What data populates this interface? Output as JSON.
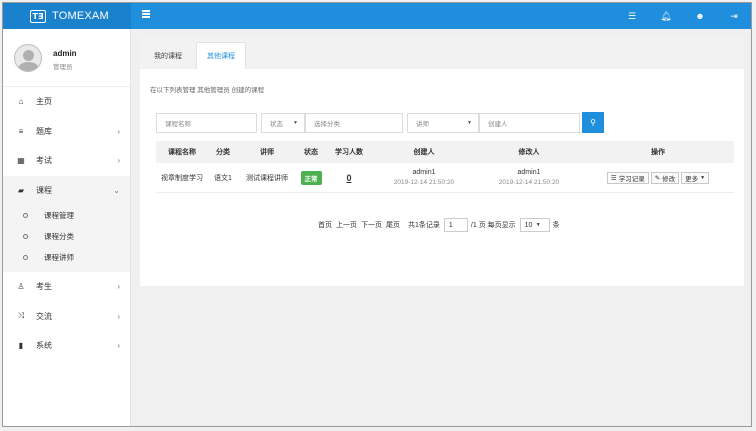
{
  "brand": {
    "logo": "T∃",
    "name": "TOMEXAM"
  },
  "topbar": {
    "icons": [
      "list-icon",
      "bell-icon",
      "user-icon",
      "logout-icon"
    ]
  },
  "user": {
    "name": "admin",
    "role": "管理员"
  },
  "nav": [
    {
      "label": "主页",
      "icon": "home-icon",
      "has_chevron": false
    },
    {
      "label": "题库",
      "icon": "database-icon",
      "has_chevron": true
    },
    {
      "label": "考试",
      "icon": "calendar-icon",
      "has_chevron": true
    },
    {
      "label": "课程",
      "icon": "book-icon",
      "has_chevron": true,
      "open": true
    },
    {
      "label": "考生",
      "icon": "user-icon",
      "has_chevron": true
    },
    {
      "label": "交流",
      "icon": "shuffle-icon",
      "has_chevron": true
    },
    {
      "label": "系统",
      "icon": "device-icon",
      "has_chevron": true
    }
  ],
  "subnav": [
    "课程管理",
    "课程分类",
    "课程讲师"
  ],
  "tabs": [
    "我的课程",
    "其他课程"
  ],
  "hint": "在以下列表管理 其他管理员 创建的课程",
  "search": {
    "name_placeholder": "课程名称",
    "status": "状态",
    "category_placeholder": "选择分类",
    "teacher": "讲师",
    "creator_placeholder": "创建人"
  },
  "table": {
    "headers": [
      "课程名称",
      "分类",
      "讲师",
      "状态",
      "学习人数",
      "创建人",
      "修改人",
      "操作"
    ],
    "rows": [
      {
        "name": "视章制度学习",
        "category": "语文1",
        "teacher": "测试课程讲师",
        "status": "正常",
        "learners": "0",
        "creator": "admin1",
        "created_at": "2019-12-14 21:50:20",
        "modifier": "admin1",
        "modified_at": "2019-12-14 21:50:20",
        "actions": [
          "学习记录",
          "修改",
          "更多"
        ]
      }
    ]
  },
  "pager": {
    "first": "首页",
    "prev": "上一页",
    "next": "下一页",
    "last": "尾页",
    "total": "共1条记录",
    "page": "1",
    "pages_suffix": "/1 页 每页显示",
    "page_size": "10",
    "unit": "条"
  },
  "colors": {
    "accent": "#1f8fdd",
    "status_ok": "#4caf50"
  }
}
